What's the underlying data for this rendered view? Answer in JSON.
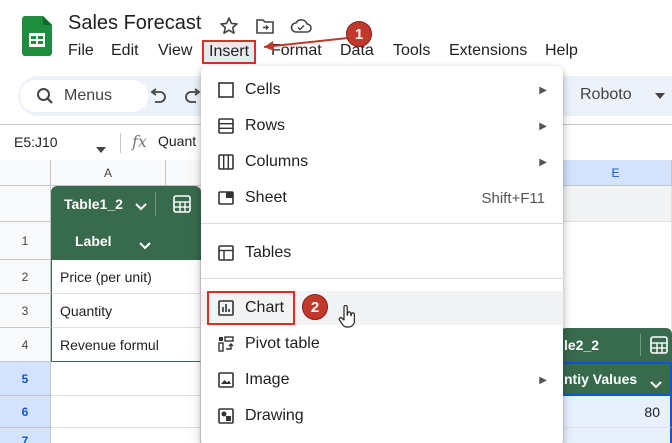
{
  "app": {
    "title": "Sales Forecast",
    "icons": [
      "sheets-logo",
      "star-icon",
      "move-folder-icon",
      "cloud-icon"
    ]
  },
  "menubar": {
    "items": [
      "File",
      "Edit",
      "View",
      "Insert",
      "Format",
      "Data",
      "Tools",
      "Extensions",
      "Help"
    ],
    "active": "Insert"
  },
  "toolbar": {
    "search_label": "Menus",
    "font": "Roboto",
    "icons": [
      "search-icon",
      "undo-icon",
      "redo-icon",
      "font-dropdown-icon"
    ]
  },
  "formula_bar": {
    "name_box": "E5:J10",
    "fx_label": "fx",
    "content": "Quant"
  },
  "grid": {
    "col_headers": {
      "a": "A",
      "e": "E"
    },
    "rows": [
      "1",
      "2",
      "3",
      "4",
      "5",
      "6",
      "7"
    ],
    "table1": {
      "name": "Table1_2",
      "header": "Label"
    },
    "column_a": [
      "Price (per unit)",
      "Quantity",
      "Revenue formul"
    ],
    "table2": {
      "name": "le2_2",
      "header": "ntiy Values",
      "value_row6": "80"
    }
  },
  "insert_menu": {
    "items": [
      {
        "label": "Cells",
        "icon": "cells-icon",
        "submenu": true
      },
      {
        "label": "Rows",
        "icon": "rows-icon",
        "submenu": true
      },
      {
        "label": "Columns",
        "icon": "columns-icon",
        "submenu": true
      },
      {
        "label": "Sheet",
        "icon": "sheet-icon",
        "shortcut": "Shift+F11"
      },
      {
        "label": "Tables",
        "icon": "tables-icon"
      },
      {
        "label": "Chart",
        "icon": "chart-icon",
        "highlighted": true
      },
      {
        "label": "Pivot table",
        "icon": "pivot-table-icon"
      },
      {
        "label": "Image",
        "icon": "image-icon",
        "submenu": true
      },
      {
        "label": "Drawing",
        "icon": "drawing-icon"
      }
    ]
  },
  "annotations": {
    "step1": "1",
    "step2": "2",
    "accent": "#d93025",
    "table_green": "#386a4d"
  }
}
